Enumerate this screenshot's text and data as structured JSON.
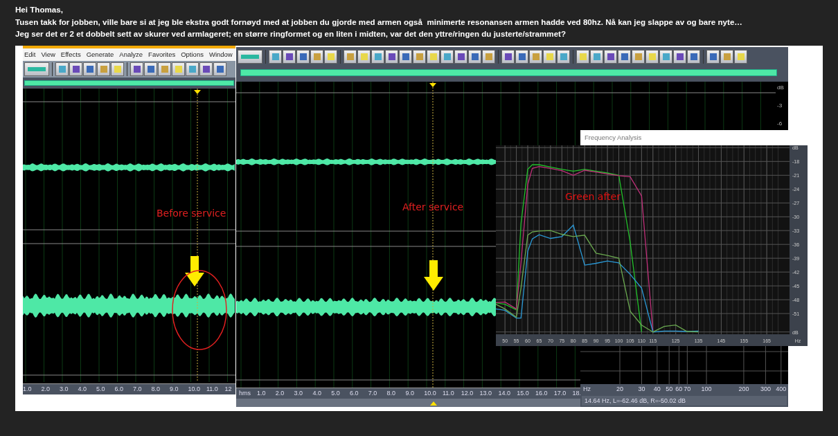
{
  "message": {
    "greeting": "Hei Thomas,",
    "lines": [
      "Tusen takk for jobben, ville bare si at jeg ble ekstra godt fornøyd med at jobben du gjorde med armen også  minimerte resonansen armen hadde ved 80hz. Nå kan jeg slappe av og bare nyte…",
      "Jeg ser det er 2 et dobbelt sett av skurer ved armlageret; en større ringformet og en liten i midten, var det den yttre/ringen du justerte/strammet?"
    ]
  },
  "attachment": {
    "left_window": {
      "menu": [
        "Edit",
        "View",
        "Effects",
        "Generate",
        "Analyze",
        "Favorites",
        "Options",
        "Window"
      ],
      "annotation": "Before service",
      "ruler": [
        "1.0",
        "2.0",
        "3.0",
        "4.0",
        "5.0",
        "6.0",
        "7.0",
        "8.0",
        "9.0",
        "10.0",
        "11.0",
        "12"
      ]
    },
    "middle_window": {
      "annotation": "After service",
      "level_scale": [
        "dB",
        "-3",
        "-6"
      ],
      "ruler_unit": "hms",
      "ruler": [
        "1.0",
        "2.0",
        "3.0",
        "4.0",
        "5.0",
        "6.0",
        "7.0",
        "8.0",
        "9.0",
        "10.0",
        "11.0",
        "12.0",
        "13.0",
        "14.0",
        "15.0",
        "16.0",
        "17.0",
        "18."
      ]
    },
    "frequency_analysis": {
      "title": "Frequency Analysis",
      "chart_data": {
        "type": "line",
        "xlabel": "Hz",
        "grid": true,
        "x": [
          46,
          50,
          55,
          57,
          60,
          62,
          65,
          70,
          75,
          80,
          85,
          90,
          95,
          100,
          105,
          110,
          115,
          120,
          125,
          130,
          135
        ],
        "series": [
          {
            "color": "#22c02a",
            "values": [
              -48.7,
              -49,
              -50.2,
              -31.5,
              -19.7,
              -18.7,
              -18.7,
              -19.2,
              -19.7,
              -20.1,
              -19.7,
              -20.1,
              -20.5,
              -21,
              -35.5,
              -55,
              null,
              null,
              null,
              null,
              null
            ]
          },
          {
            "color": "#c0307a",
            "values": [
              -48.6,
              -48.5,
              -50,
              -40,
              -23,
              -19.5,
              -19.1,
              -19.5,
              -20,
              -21,
              -19.9,
              -20.3,
              -20.7,
              -21.1,
              -21.3,
              -25.5,
              -55,
              null,
              null,
              null,
              null
            ]
          },
          {
            "color": "#2a9ad8",
            "values": [
              -50,
              -50.3,
              -52,
              -52,
              -37.5,
              -34.8,
              -33.9,
              -34.7,
              -34.3,
              -31.8,
              -40.5,
              -40.1,
              -39.6,
              -40,
              -42.5,
              -45.5,
              -55,
              -54.8,
              -54.8,
              -54.9,
              -54.8
            ]
          },
          {
            "color": "#6aa84f",
            "values": [
              -49,
              -50,
              -51.8,
              -45.5,
              -34,
              -33.3,
              -33.1,
              -33,
              -33.8,
              -34.3,
              -34,
              -37.9,
              -38.4,
              -39,
              -50.5,
              -53.5,
              -55,
              -53.8,
              -53.5,
              -54.9,
              -55
            ]
          }
        ],
        "xlim": [
          46,
          175
        ],
        "ylim": [
          -55.5,
          -14.5
        ],
        "xticks": [
          50,
          55,
          60,
          65,
          70,
          75,
          80,
          85,
          90,
          95,
          100,
          105,
          110,
          115,
          125,
          135,
          145,
          155,
          165
        ],
        "yticks": [
          {
            "value": -15,
            "label": "dB"
          },
          -18,
          -21,
          -24,
          -27,
          -30,
          -33,
          -36,
          -39,
          -42,
          -45,
          -48,
          -51,
          {
            "value": -55,
            "label": "dB"
          }
        ],
        "annotations": [
          "Green after"
        ]
      }
    },
    "spectrum_panel": {
      "ruler_unit": "Hz",
      "ruler": [
        "20",
        "30",
        "40",
        "50",
        "60",
        "70",
        "100",
        "200",
        "300",
        "400"
      ],
      "status": "14.64 Hz, L=-62.46 dB, R=-50.02 dB"
    }
  }
}
